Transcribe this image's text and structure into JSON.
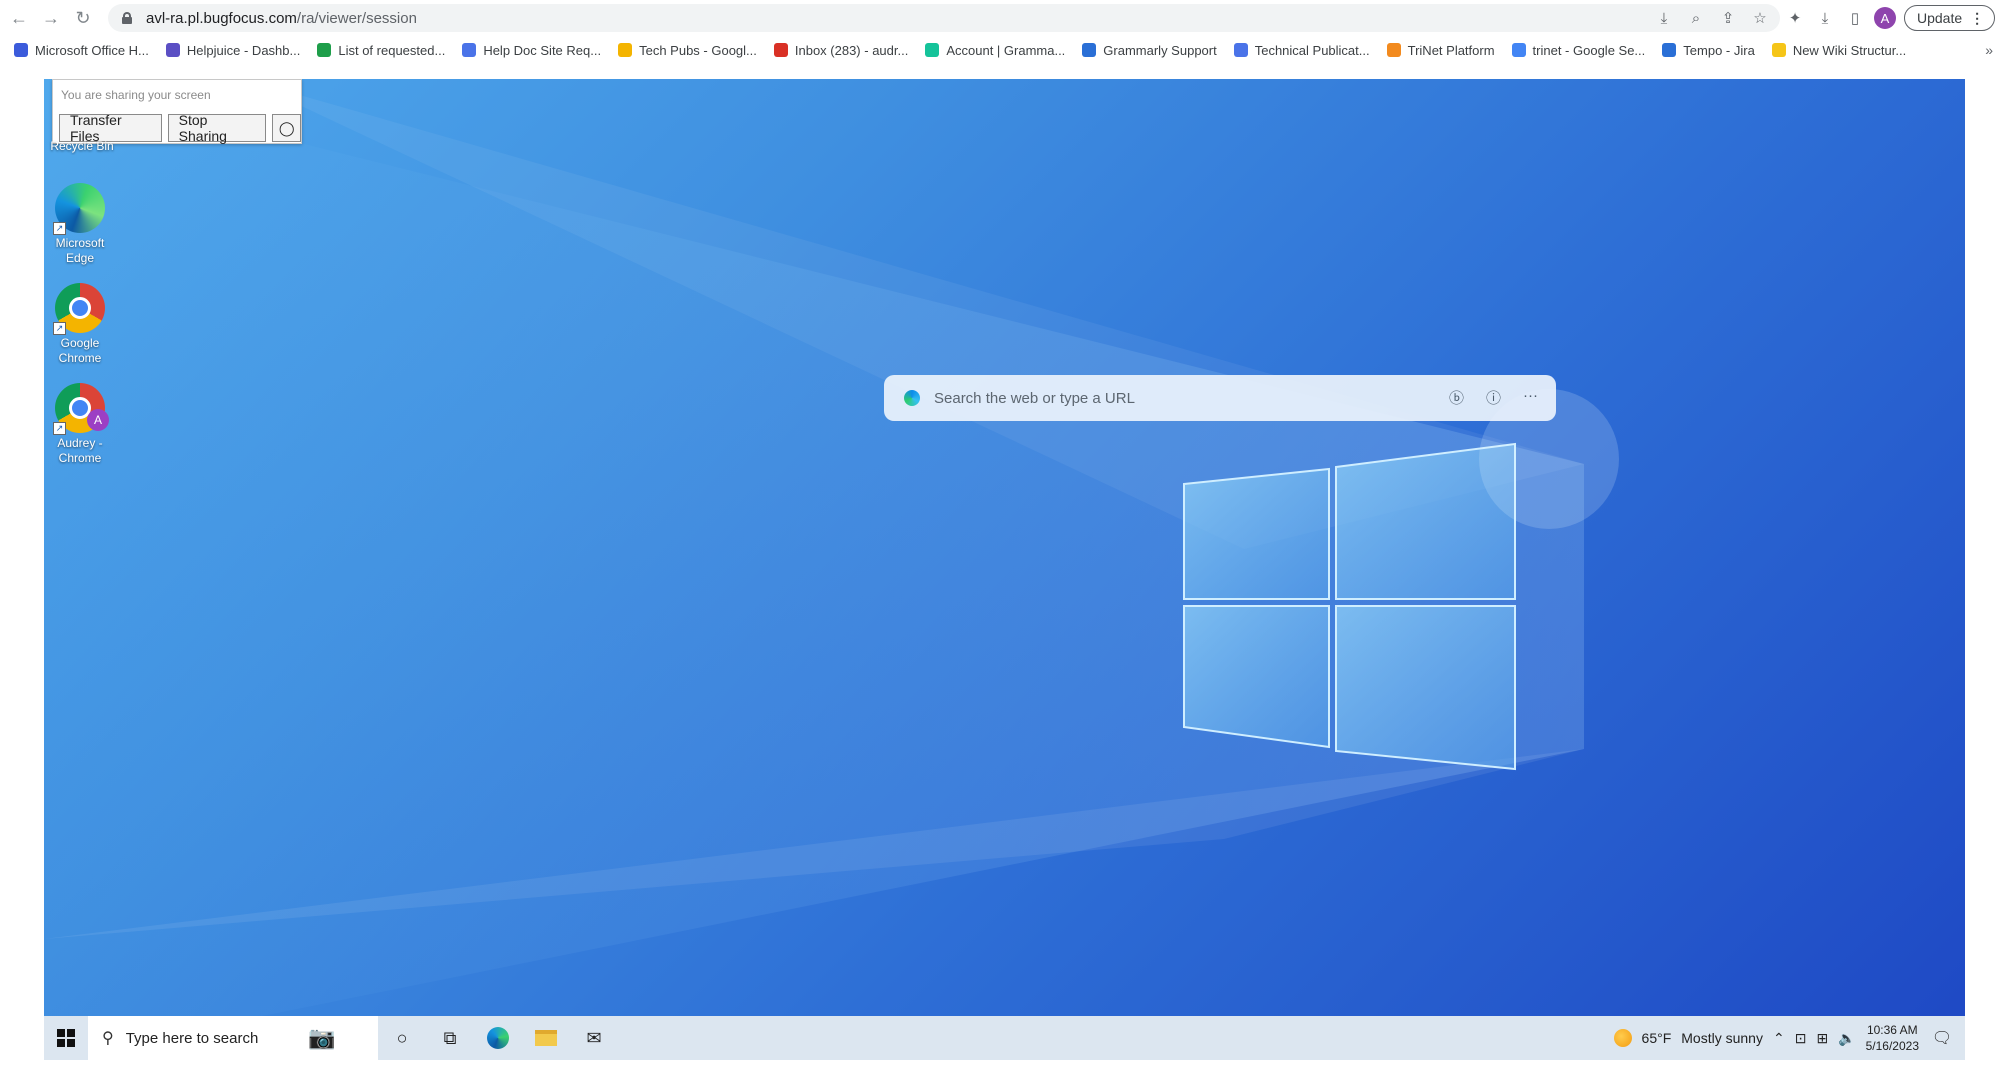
{
  "browser": {
    "url_host": "avl-ra.pl.bugfocus.com",
    "url_path": "/ra/viewer/session",
    "update_label": "Update",
    "avatar_letter": "A",
    "bookmarks": [
      {
        "label": "Microsoft Office H...",
        "color": "#3b5bdb"
      },
      {
        "label": "Helpjuice - Dashb...",
        "color": "#5b4fc4"
      },
      {
        "label": "List of requested...",
        "color": "#1e9e4a"
      },
      {
        "label": "Help Doc Site Req...",
        "color": "#4a73e8"
      },
      {
        "label": "Tech Pubs - Googl...",
        "color": "#f4b400"
      },
      {
        "label": "Inbox (283) - audr...",
        "color": "#d93025"
      },
      {
        "label": "Account | Gramma...",
        "color": "#15c39a"
      },
      {
        "label": "Grammarly Support",
        "color": "#2a6fd6"
      },
      {
        "label": "Technical Publicat...",
        "color": "#4a73e8"
      },
      {
        "label": "TriNet Platform",
        "color": "#f28a1e"
      },
      {
        "label": "trinet - Google Se...",
        "color": "#4285f4"
      },
      {
        "label": "Tempo - Jira",
        "color": "#2a6fd6"
      },
      {
        "label": "New Wiki Structur...",
        "color": "#f5c518"
      }
    ],
    "bookmarks_more": "»"
  },
  "share_panel": {
    "message": "You are sharing your screen",
    "transfer_label": "Transfer Files",
    "stop_label": "Stop Sharing",
    "partial_label": "Recycle Bin"
  },
  "desktop_icons": [
    {
      "label_line1": "Microsoft",
      "label_line2": "Edge"
    },
    {
      "label_line1": "Google",
      "label_line2": "Chrome"
    },
    {
      "label_line1": "Audrey -",
      "label_line2": "Chrome",
      "badge": "A"
    }
  ],
  "edge_search": {
    "placeholder": "Search the web or type a URL"
  },
  "taskbar": {
    "search_placeholder": "Type here to search",
    "weather_temp": "65°F",
    "weather_desc": "Mostly sunny",
    "time": "10:36 AM",
    "date": "5/16/2023"
  }
}
